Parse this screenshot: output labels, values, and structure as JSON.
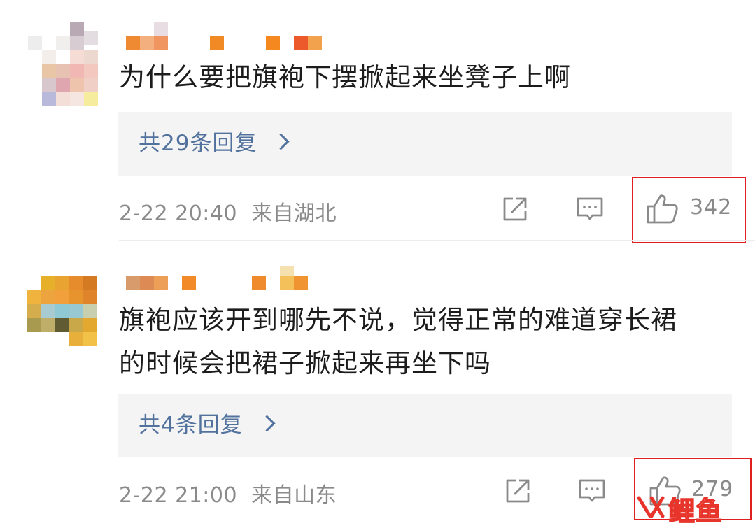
{
  "comments": [
    {
      "text": "为什么要把旗袍下摆掀起来坐凳子上啊",
      "replies_label": "共29条回复",
      "timestamp": "2-22 20:40",
      "location": "来自湖北",
      "likes": "342",
      "icons": [
        "share-icon",
        "comment-icon",
        "thumbs-up-icon"
      ]
    },
    {
      "text": "旗袍应该开到哪先不说，觉得正常的难道穿长裙\n的时候会把裙子掀起来再坐下吗",
      "replies_label": "共4条回复",
      "timestamp": "2-22 21:00",
      "location": "来自山东",
      "likes": "279",
      "icons": [
        "share-icon",
        "comment-icon",
        "thumbs-up-icon"
      ]
    }
  ],
  "watermark": {
    "text": "鲤鱼"
  },
  "colors": {
    "reply_link": "#52729e",
    "meta_text": "#8a8a8a",
    "highlight_border": "#e02020",
    "reply_bg": "#f4f4f4"
  }
}
